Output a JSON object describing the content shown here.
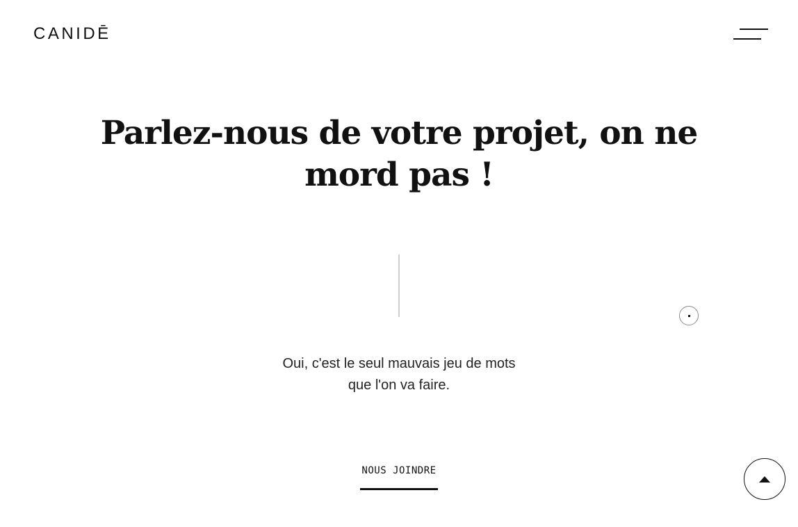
{
  "header": {
    "logo_text": "CANIDĒ",
    "menu_icon": "hamburger-menu-icon"
  },
  "hero": {
    "headline_line1": "Parlez-nous de votre projet, on ne",
    "headline_line2": "mord pas !",
    "subtext_line1": "Oui, c'est le seul mauvais jeu de mots",
    "subtext_line2": "que l'on va faire."
  },
  "cta": {
    "label": "NOUS JOINDRE"
  },
  "scroll_top": {
    "icon": "arrow-up-icon"
  },
  "colors": {
    "background": "#ffffff",
    "text": "#111111",
    "divider": "#cfcfcf"
  }
}
